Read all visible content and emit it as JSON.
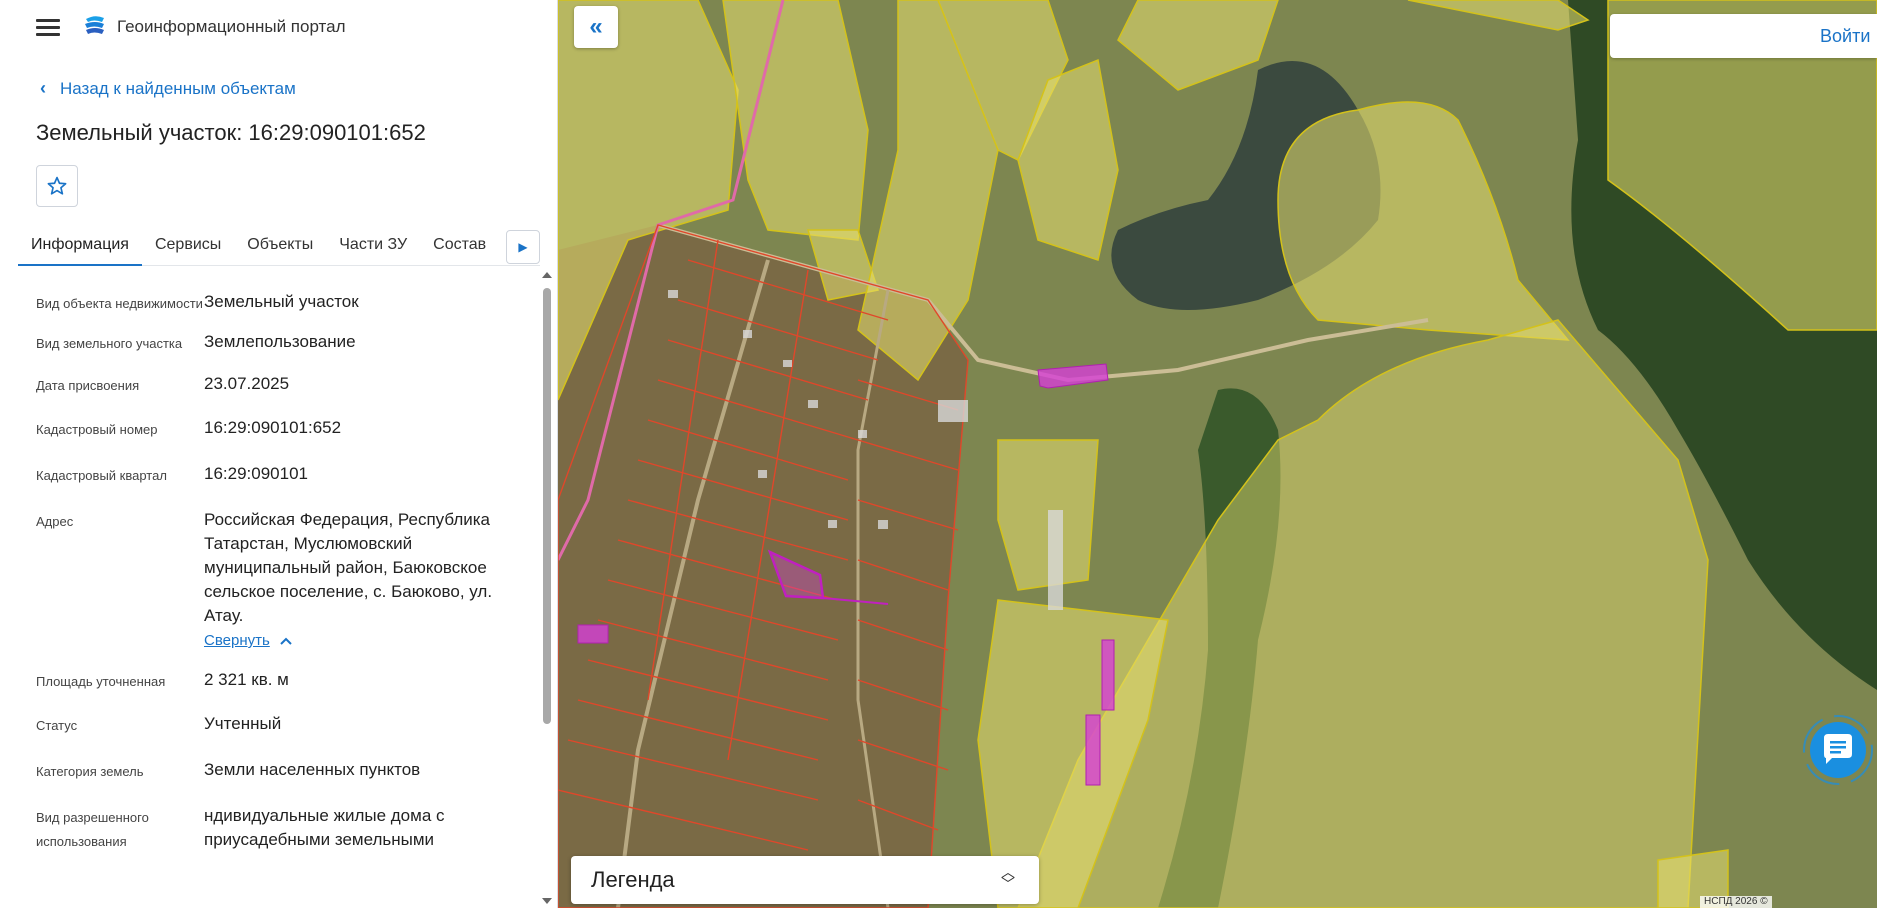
{
  "header": {
    "title": "Геоинформационный портал"
  },
  "navigation": {
    "back_label": "Назад к найденным объектам"
  },
  "object": {
    "title": "Земельный участок: 16:29:090101:652"
  },
  "tabs": [
    {
      "label": "Информация",
      "active": true
    },
    {
      "label": "Сервисы",
      "active": false
    },
    {
      "label": "Объекты",
      "active": false
    },
    {
      "label": "Части ЗУ",
      "active": false
    },
    {
      "label": "Состав",
      "active": false
    }
  ],
  "properties": [
    {
      "label": "Вид объекта недвижимости",
      "value": "Земельный участок"
    },
    {
      "label": "Вид земельного участка",
      "value": "Землепользование"
    },
    {
      "label": "Дата присвоения",
      "value": "23.07.2025"
    },
    {
      "label": "Кадастровый номер",
      "value": "16:29:090101:652"
    },
    {
      "label": "Кадастровый квартал",
      "value": "16:29:090101"
    },
    {
      "label": "Адрес",
      "value": "Российская Федерация, Республика Татарстан, Муслюмовский муниципальный район, Баюковское сельское поселение, с. Баюково, ул. Атау."
    },
    {
      "label": "Площадь уточненная",
      "value": "2 321 кв. м"
    },
    {
      "label": "Статус",
      "value": "Учтенный"
    },
    {
      "label": "Категория земель",
      "value": "Земли населенных пунктов"
    },
    {
      "label": "Вид разрешенного использования",
      "value": "ндивидуальные жилые дома с приусадебными земельными"
    }
  ],
  "collapse_label": "Свернуть",
  "map": {
    "login_label": "Войти",
    "legend_label": "Легенда",
    "attribution": "НСПД 2026 ©",
    "colors": {
      "parcel_fill": "#e8e070",
      "parcel_stroke": "#d4c21a",
      "selected": "#d63fd6",
      "plot_lines": "#e0472a",
      "water": "#3c4a3e",
      "forest": "#2d4a24",
      "accent": "#1a73c7"
    }
  },
  "icons": {
    "menu": "hamburger-icon",
    "logo": "portal-logo-icon",
    "back": "chevron-left-icon",
    "favorite": "star-icon",
    "tab_scroll": "triangle-right-icon",
    "collapse": "chevron-up-icon",
    "panel_toggle": "double-chevron-left-icon",
    "legend_toggle": "up-down-chevron-icon",
    "chat": "chat-bubble-icon"
  }
}
